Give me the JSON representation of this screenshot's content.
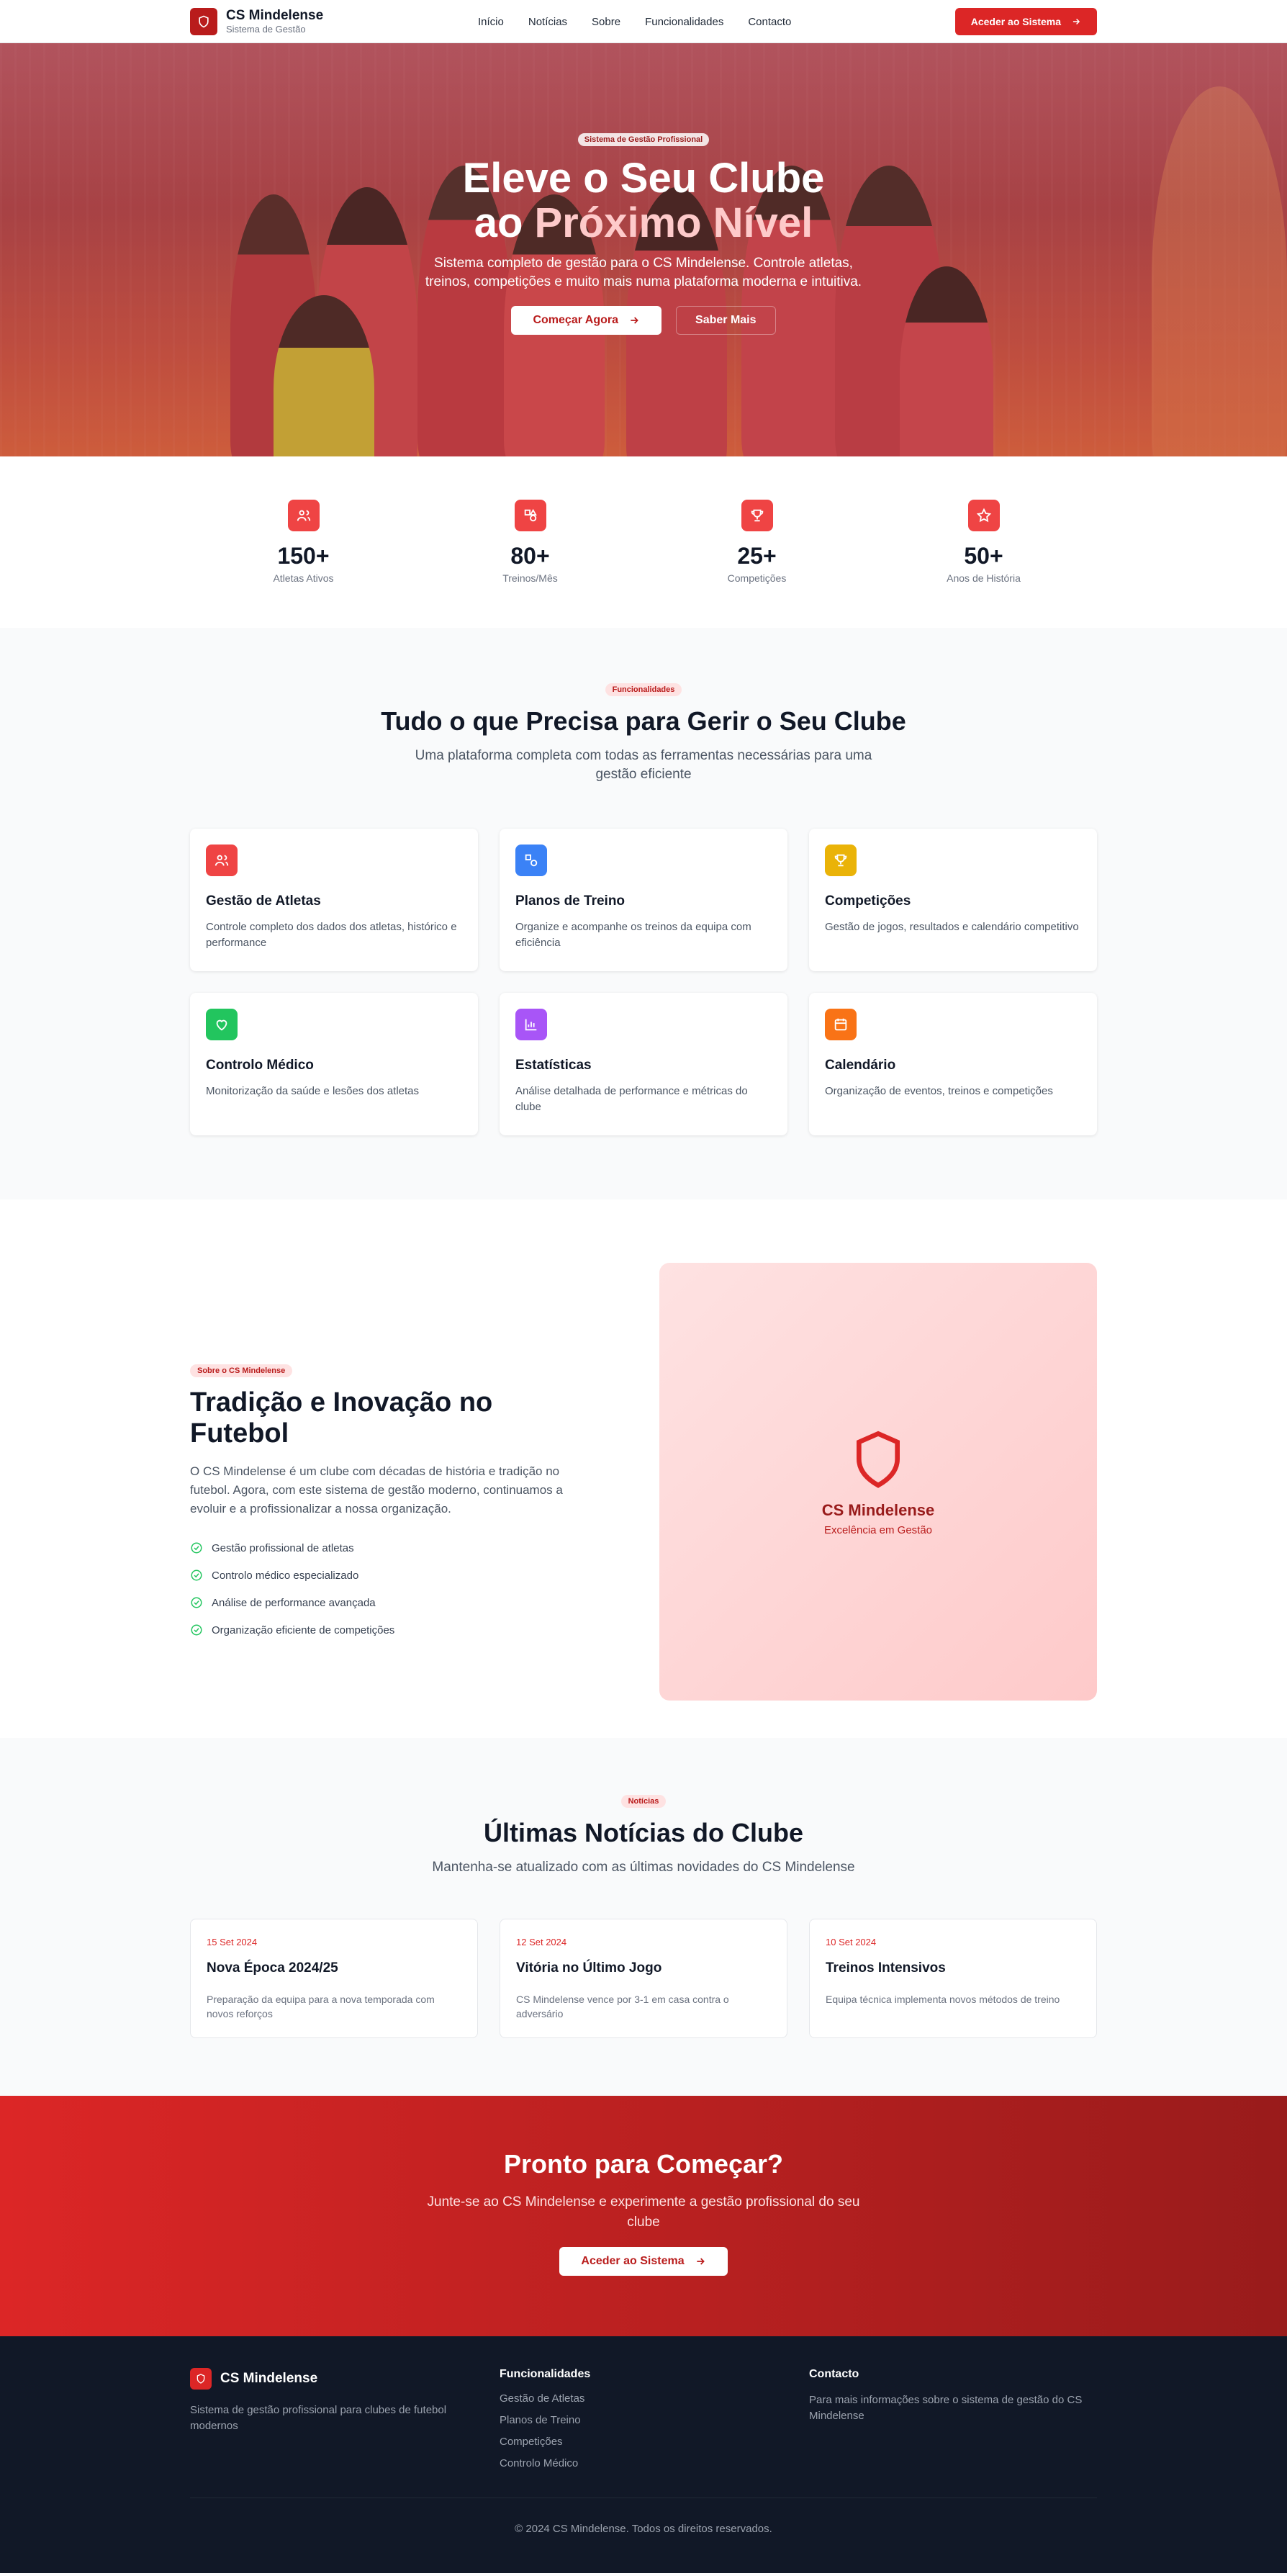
{
  "nav": {
    "brand_name": "CS Mindelense",
    "brand_sub": "Sistema de Gestão",
    "links": [
      "Início",
      "Notícias",
      "Sobre",
      "Funcionalidades",
      "Contacto"
    ],
    "cta": "Aceder ao Sistema"
  },
  "hero": {
    "badge": "Sistema de Gestão Profissional",
    "title_line1": "Eleve o Seu Clube",
    "title_pre": "ao ",
    "title_accent": "Próximo Nível",
    "description": "Sistema completo de gestão para o CS Mindelense. Controle atletas, treinos, competições e muito mais numa plataforma moderna e intuitiva.",
    "primary_btn": "Começar Agora",
    "secondary_btn": "Saber Mais"
  },
  "stats": [
    {
      "value": "150+",
      "label": "Atletas Ativos",
      "icon": "users-icon"
    },
    {
      "value": "80+",
      "label": "Treinos/Mês",
      "icon": "shapes-icon"
    },
    {
      "value": "25+",
      "label": "Competições",
      "icon": "trophy-icon"
    },
    {
      "value": "50+",
      "label": "Anos de História",
      "icon": "star-icon"
    }
  ],
  "features": {
    "pill": "Funcionalidades",
    "title": "Tudo o que Precisa para Gerir o Seu Clube",
    "subtitle": "Uma plataforma completa com todas as ferramentas necessárias para uma gestão eficiente",
    "items": [
      {
        "title": "Gestão de Atletas",
        "desc": "Controle completo dos dados dos atletas, histórico e performance",
        "color": "#ef4444",
        "icon": "users-icon"
      },
      {
        "title": "Planos de Treino",
        "desc": "Organize e acompanhe os treinos da equipa com eficiência",
        "color": "#3b82f6",
        "icon": "shapes-icon"
      },
      {
        "title": "Competições",
        "desc": "Gestão de jogos, resultados e calendário competitivo",
        "color": "#eab308",
        "icon": "trophy-icon"
      },
      {
        "title": "Controlo Médico",
        "desc": "Monitorização da saúde e lesões dos atletas",
        "color": "#22c55e",
        "icon": "heart-icon"
      },
      {
        "title": "Estatísticas",
        "desc": "Análise detalhada de performance e métricas do clube",
        "color": "#a855f7",
        "icon": "bar-chart-icon"
      },
      {
        "title": "Calendário",
        "desc": "Organização de eventos, treinos e competições",
        "color": "#f97316",
        "icon": "calendar-icon"
      }
    ]
  },
  "about": {
    "pill": "Sobre o CS Mindelense",
    "title": "Tradição e Inovação no Futebol",
    "description": "O CS Mindelense é um clube com décadas de história e tradição no futebol. Agora, com este sistema de gestão moderno, continuamos a evoluir e a profissionalizar a nossa organização.",
    "checks": [
      "Gestão profissional de atletas",
      "Controlo médico especializado",
      "Análise de performance avançada",
      "Organização eficiente de competições"
    ],
    "card_name": "CS Mindelense",
    "card_tag": "Excelência em Gestão"
  },
  "news": {
    "pill": "Notícias",
    "title": "Últimas Notícias do Clube",
    "subtitle": "Mantenha-se atualizado com as últimas novidades do CS Mindelense",
    "items": [
      {
        "date": "15 Set 2024",
        "title": "Nova Época 2024/25",
        "desc": "Preparação da equipa para a nova temporada com novos reforços"
      },
      {
        "date": "12 Set 2024",
        "title": "Vitória no Último Jogo",
        "desc": "CS Mindelense vence por 3-1 em casa contra o adversário"
      },
      {
        "date": "10 Set 2024",
        "title": "Treinos Intensivos",
        "desc": "Equipa técnica implementa novos métodos de treino"
      }
    ]
  },
  "cta": {
    "title": "Pronto para Começar?",
    "description": "Junte-se ao CS Mindelense e experimente a gestão profissional do seu clube",
    "button": "Aceder ao Sistema"
  },
  "footer": {
    "brand": "CS Mindelense",
    "about": "Sistema de gestão profissional para clubes de futebol modernos",
    "features_heading": "Funcionalidades",
    "features_links": [
      "Gestão de Atletas",
      "Planos de Treino",
      "Competições",
      "Controlo Médico"
    ],
    "contact_heading": "Contacto",
    "contact_text": "Para mais informações sobre o sistema de gestão do CS Mindelense",
    "copyright": "© 2024 CS Mindelense. Todos os direitos reservados."
  }
}
